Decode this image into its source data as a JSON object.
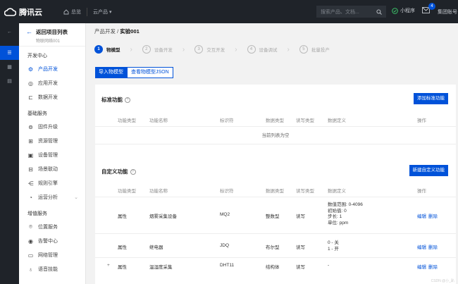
{
  "topbar": {
    "brand": "腾讯云",
    "home": "总览",
    "products": "云产品 ▾",
    "search_placeholder": "搜索产品、文档...",
    "mini": "小程序",
    "badge_count": "4",
    "account": "集团账号"
  },
  "sidebar": {
    "back_title": "返回项目列表",
    "back_sub": "物联网络001",
    "groups": [
      {
        "label": "开发中心",
        "items": [
          {
            "label": "产品开发",
            "icon": "gear-icon",
            "active": true
          },
          {
            "label": "应用开发",
            "icon": "app-icon"
          },
          {
            "label": "数据开发",
            "icon": "data-icon"
          }
        ]
      },
      {
        "label": "基础服务",
        "items": [
          {
            "label": "固件升级",
            "icon": "upgrade-icon"
          },
          {
            "label": "资源管理",
            "icon": "resource-icon"
          },
          {
            "label": "设备管理",
            "icon": "device-icon"
          },
          {
            "label": "场景联动",
            "icon": "scene-icon"
          },
          {
            "label": "规则引擎",
            "icon": "rule-icon"
          },
          {
            "label": "运营分析",
            "icon": "analysis-icon",
            "chevron": true
          }
        ]
      },
      {
        "label": "增值服务",
        "items": [
          {
            "label": "位置服务",
            "icon": "location-icon"
          },
          {
            "label": "告警中心",
            "icon": "alarm-icon"
          },
          {
            "label": "网络管理",
            "icon": "network-icon"
          },
          {
            "label": "语音技能",
            "icon": "voice-icon"
          }
        ]
      }
    ]
  },
  "breadcrumb": {
    "parent": "产品开发",
    "sep": "/",
    "current": "实验001"
  },
  "steps": [
    {
      "n": "1",
      "label": "物模型"
    },
    {
      "n": "2",
      "label": "设备开发"
    },
    {
      "n": "3",
      "label": "交互开发"
    },
    {
      "n": "4",
      "label": "设备调试"
    },
    {
      "n": "5",
      "label": "批量投产"
    }
  ],
  "actions": {
    "import": "导入物模型",
    "view_json": "查看物模型JSON"
  },
  "standard": {
    "title": "标准功能",
    "add": "添加标准功能",
    "empty": "当前列表为空"
  },
  "custom": {
    "title": "自定义功能",
    "add": "新建自定义功能"
  },
  "columns": [
    "功能类型",
    "功能名称",
    "标识符",
    "数据类型",
    "读写类型",
    "数据定义",
    "操作"
  ],
  "rows": [
    {
      "expand": "",
      "type": "属性",
      "name": "烟雾采集设备",
      "id": "MQ2",
      "dtype": "整数型",
      "rw": "读写",
      "def": [
        "数值范围: 0-4096",
        "初始值: 0",
        "步长: 1",
        "单位: ppm"
      ],
      "edit": "编辑",
      "del": "删除"
    },
    {
      "expand": "",
      "type": "属性",
      "name": "继电器",
      "id": "JDQ",
      "dtype": "布尔型",
      "rw": "读写",
      "def": [
        "0 - 关",
        "1 - 开"
      ],
      "edit": "编辑",
      "del": "删除"
    },
    {
      "expand": "+",
      "type": "属性",
      "name": "温湿度采集",
      "id": "DHT11",
      "dtype": "结构体",
      "rw": "读写",
      "def": [
        "-"
      ],
      "edit": "编辑",
      "del": "删除"
    }
  ],
  "watermark": "CSDN @小_趴"
}
